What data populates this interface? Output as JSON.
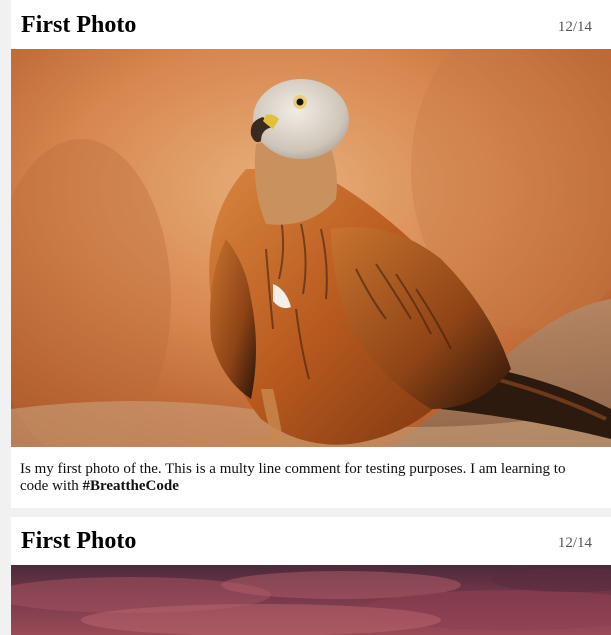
{
  "posts": [
    {
      "title": "First Photo",
      "date": "12/14",
      "caption_text": "Is my first photo of the. This is a multy line comment for testing purposes. I am learning to code with ",
      "caption_hashtag": "#BreattheCode",
      "photo": "red-kite-bird-photo"
    },
    {
      "title": "First Photo",
      "date": "12/14",
      "photo": "sunset-sky-photo"
    }
  ],
  "colors": {
    "page_background": "#f1f1f1",
    "card_background": "#ffffff",
    "date_text": "#555555"
  }
}
